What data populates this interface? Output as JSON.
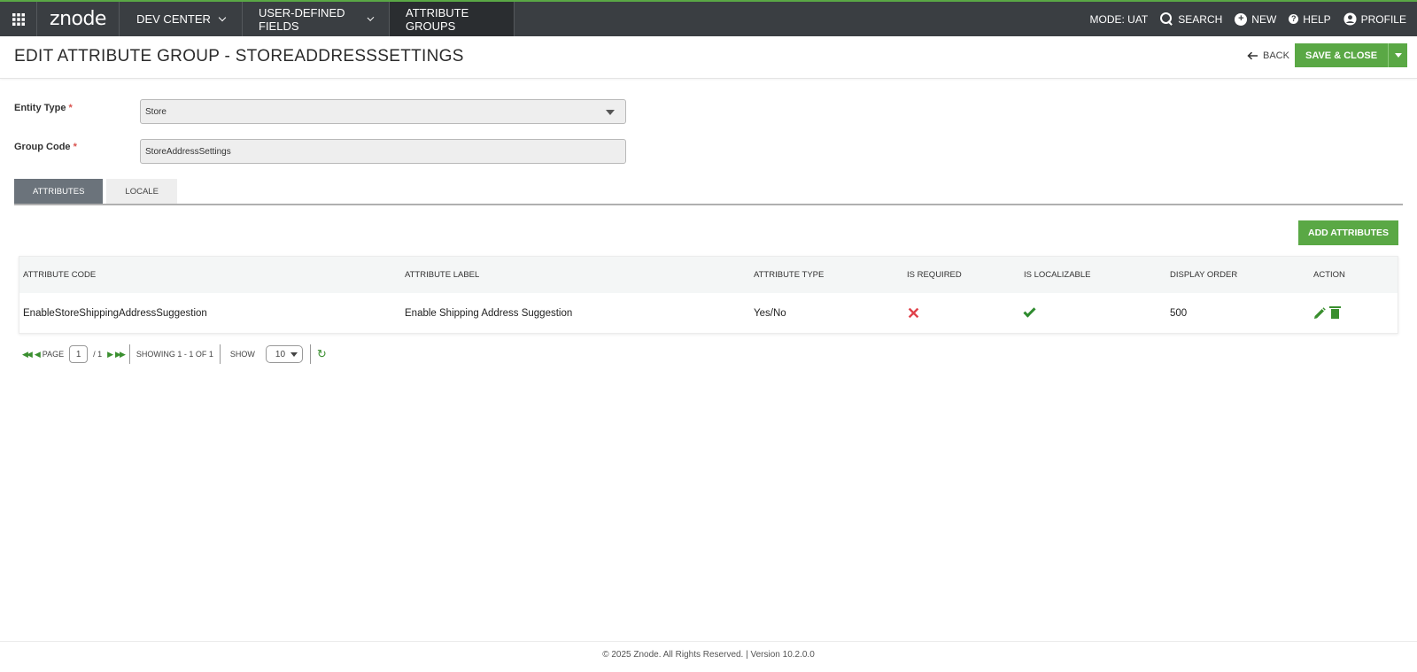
{
  "topnav": {
    "logo": "znode",
    "menus": [
      {
        "label": "DEV CENTER"
      },
      {
        "label": "USER-DEFINED FIELDS"
      },
      {
        "label": "ATTRIBUTE GROUPS"
      }
    ],
    "mode": "MODE: UAT",
    "search": "SEARCH",
    "new": "NEW",
    "help": "HELP",
    "profile": "PROFILE"
  },
  "header": {
    "title": "EDIT ATTRIBUTE GROUP  -  STOREADDRESSSETTINGS",
    "back": "BACK",
    "save_close": "SAVE & CLOSE"
  },
  "form": {
    "entity_type_label": "Entity Type",
    "entity_type_value": "Store",
    "group_code_label": "Group Code",
    "group_code_value": "StoreAddressSettings",
    "required_mark": "*"
  },
  "tabs": [
    {
      "label": "ATTRIBUTES"
    },
    {
      "label": "LOCALE"
    }
  ],
  "add_attributes": "ADD ATTRIBUTES",
  "table": {
    "columns": [
      "ATTRIBUTE CODE",
      "ATTRIBUTE LABEL",
      "ATTRIBUTE TYPE",
      "IS REQUIRED",
      "IS LOCALIZABLE",
      "DISPLAY ORDER",
      "ACTION"
    ],
    "rows": [
      {
        "code": "EnableStoreShippingAddressSuggestion",
        "label": "Enable Shipping Address Suggestion",
        "type": "Yes/No",
        "is_required": false,
        "is_localizable": true,
        "display_order": "500"
      }
    ]
  },
  "pager": {
    "page_label": "PAGE",
    "current_page": "1",
    "total_pages": "/ 1",
    "showing": "SHOWING 1 - 1 OF 1",
    "show_label": "SHOW",
    "page_size": "10"
  },
  "footer": "© 2025 Znode. All Rights Reserved. | Version 10.2.0.0"
}
